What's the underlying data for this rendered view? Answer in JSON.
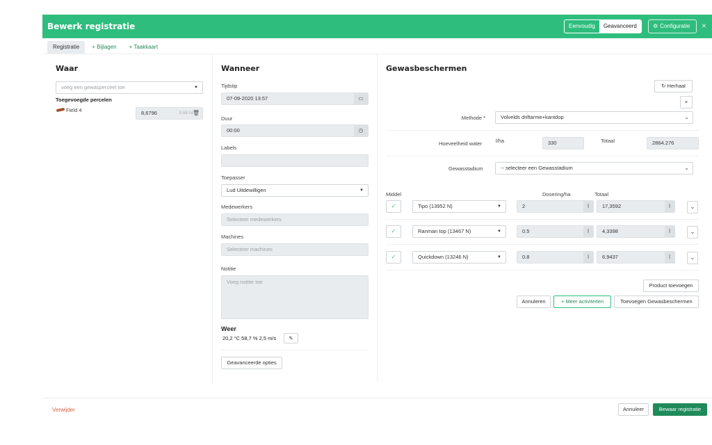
{
  "header": {
    "title": "Bewerk registratie",
    "mode_simple": "Eenvoudig",
    "mode_advanced": "Geavanceerd",
    "config_label": "Configuratie",
    "close": "×"
  },
  "tabs": [
    "Registratie",
    "+ Bijlagen",
    "+ Taakkaart"
  ],
  "waar": {
    "title": "Waar",
    "plot_placeholder": "voeg een gewasperceel toe",
    "added_label": "Toegevoegde percelen",
    "field_name": "Field 4",
    "field_value": "8,6796",
    "field_unit": "8,68 ha"
  },
  "wanneer": {
    "title": "Wanneer",
    "tijdstip_label": "Tijdstip",
    "tijdstip_value": "07-09-2020 13:57",
    "duur_label": "Duur",
    "duur_value": "00:00",
    "labels_label": "Labels",
    "toepasser_label": "Toepasser",
    "toepasser_value": "Lud Uitdewilligen",
    "medewerkers_label": "Medewerkers",
    "medewerkers_placeholder": "Selecteer medewerkers",
    "machines_label": "Machines",
    "machines_placeholder": "Selecteer machines",
    "notitie_label": "Notitie",
    "notitie_placeholder": "Voeg notitie toe",
    "weer_label": "Weer",
    "weer_value": "20,2 °C 58,7 % 2,5 m/s",
    "advanced_options": "Geavanceerde opties"
  },
  "gewas": {
    "title": "Gewasbeschermen",
    "repeat": "Herhaal",
    "remove": "×",
    "methode_label": "Methode *",
    "methode_value": "Volvelds driftarme+kantdop",
    "water_label": "Hoeveelheid water",
    "water_unit": "l/ha",
    "water_value": "330",
    "totaal_label": "Totaal",
    "totaal_value": "2864.276",
    "stadium_label": "Gewasstadium",
    "stadium_value": "-- selecteer een Gewasstadium",
    "col_middel": "Middel",
    "col_dosering": "Dosering/ha",
    "col_totaal": "Totaal",
    "products": [
      {
        "name": "Tipo (13952 N)",
        "dose": "2",
        "dose_unit": "l",
        "total": "17,3592",
        "total_unit": "l"
      },
      {
        "name": "Ranman top (13467 N)",
        "dose": "0.5",
        "dose_unit": "l",
        "total": "4,3398",
        "total_unit": "l"
      },
      {
        "name": "Quickdown (13246 N)",
        "dose": "0.8",
        "dose_unit": "l",
        "total": "6,9437",
        "total_unit": "l"
      }
    ],
    "add_product": "Product toevoegen",
    "cancel": "Annuleren",
    "more_activities": "Meer activiteiten",
    "add_gewas": "Toevoegen Gewasbeschermen"
  },
  "footer": {
    "delete": "Verwijder",
    "cancel": "Annuleer",
    "save": "Bewaar registratie"
  }
}
